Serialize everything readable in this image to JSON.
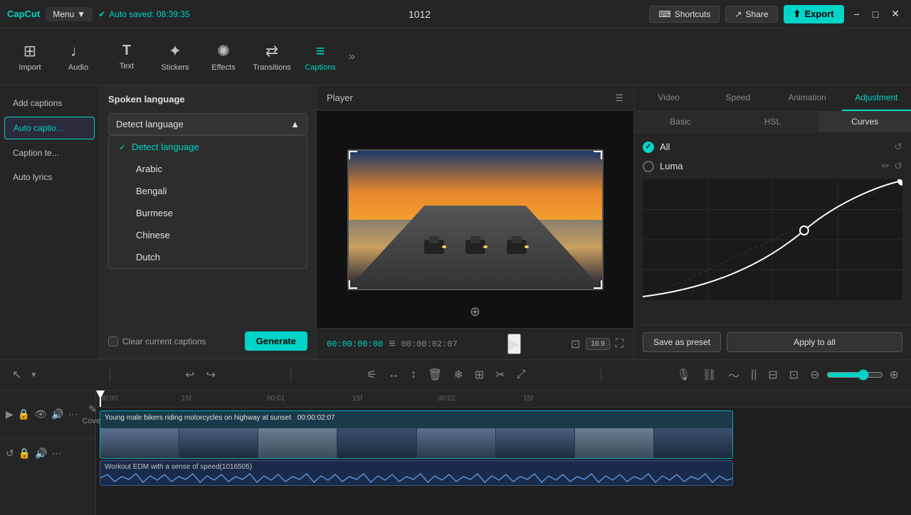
{
  "app": {
    "name": "CapCut",
    "menu_label": "Menu",
    "autosave": "Auto saved: 08:39:35",
    "project_id": "1012"
  },
  "titlebar": {
    "shortcuts": "Shortcuts",
    "share": "Share",
    "export": "Export",
    "minimize": "−",
    "maximize": "□",
    "close": "✕"
  },
  "toolbar": {
    "import": "Import",
    "audio": "Audio",
    "text": "Text",
    "stickers": "Stickers",
    "effects": "Effects",
    "transitions": "Transitions",
    "captions": "Captions",
    "expand": "»"
  },
  "captions_panel": {
    "title": "Spoken language",
    "language_options": [
      {
        "id": "detect",
        "label": "Detect language",
        "selected": true
      },
      {
        "id": "arabic",
        "label": "Arabic",
        "selected": false
      },
      {
        "id": "bengali",
        "label": "Bengali",
        "selected": false
      },
      {
        "id": "burmese",
        "label": "Burmese",
        "selected": false
      },
      {
        "id": "chinese",
        "label": "Chinese",
        "selected": false
      },
      {
        "id": "dutch",
        "label": "Dutch",
        "selected": false
      }
    ],
    "clear_label": "Clear current captions",
    "generate_label": "Generate"
  },
  "left_panel": {
    "items": [
      {
        "id": "add-captions",
        "label": "Add captions"
      },
      {
        "id": "auto-caption",
        "label": "Auto captio..."
      },
      {
        "id": "caption-te",
        "label": "Caption te..."
      },
      {
        "id": "auto-lyrics",
        "label": "Auto lyrics"
      }
    ]
  },
  "player": {
    "title": "Player",
    "time_current": "00:00:00:00",
    "time_total": "00:00:02:07",
    "aspect_ratio": "16:9"
  },
  "right_panel": {
    "tabs": [
      {
        "id": "video",
        "label": "Video"
      },
      {
        "id": "speed",
        "label": "Speed"
      },
      {
        "id": "animation",
        "label": "Animation"
      },
      {
        "id": "adjustment",
        "label": "Adjustment"
      }
    ],
    "sub_tabs": [
      {
        "id": "basic",
        "label": "Basic"
      },
      {
        "id": "hsl",
        "label": "HSL"
      },
      {
        "id": "curves",
        "label": "Curves"
      }
    ],
    "curves": {
      "channels": [
        {
          "id": "all",
          "label": "All",
          "checked": true
        },
        {
          "id": "luma",
          "label": "Luma",
          "checked": false
        }
      ],
      "save_preset": "Save as preset",
      "apply_to_all": "Apply to all"
    }
  },
  "timeline": {
    "video_track": {
      "label": "Young male bikers riding motorcycles on highway at sunset",
      "duration": "00:00:02:07"
    },
    "audio_track": {
      "label": "Workout EDM with a sense of speed(1016505)"
    },
    "cover_label": "Cover",
    "markers": [
      "00:00",
      "15f",
      "00:01",
      "15f",
      "00:02",
      "15f"
    ]
  },
  "icons": {
    "play": "▶",
    "check": "✓",
    "dropdown_arrow_up": "▲",
    "dropdown_arrow_down": "▼",
    "pencil": "✏",
    "reset": "↺",
    "mic": "🎙",
    "link": "🔗",
    "split": "⚡",
    "recenter": "⊕",
    "fullscreen": "⛶",
    "zoom_in": "⊕",
    "zoom_out": "⊖"
  }
}
